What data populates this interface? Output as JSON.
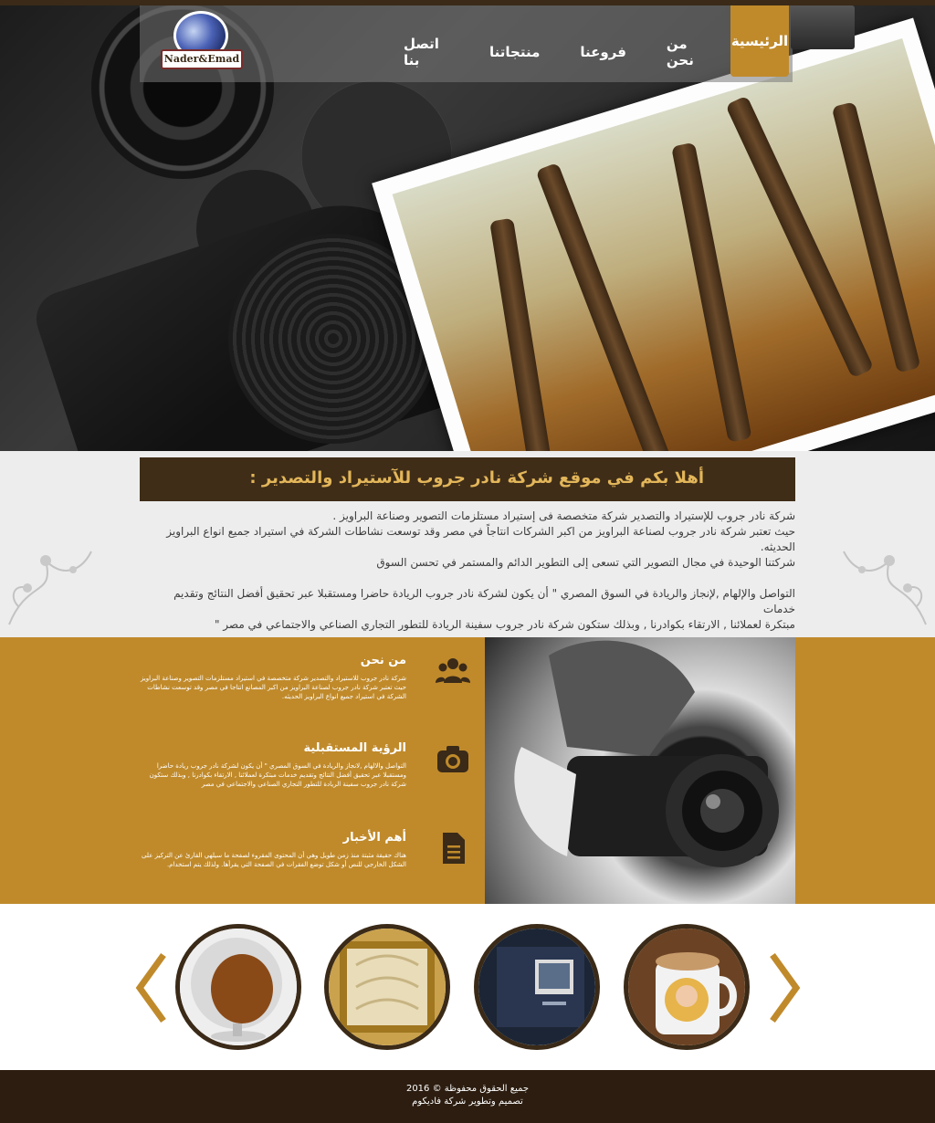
{
  "brand": {
    "logo_text": "Nader&Emad"
  },
  "nav": {
    "active": "الرئيسية",
    "items": [
      "من نحن",
      "فروعنا",
      "منتجاتنا",
      "اتصل بنا"
    ]
  },
  "welcome": {
    "title": "أهلا بكم في موقع شركة نادر جروب للآستيراد والتصدير :",
    "lines": [
      "شركة نادر جروب للإستيراد والتصدير شركة متخصصة فى إستيراد مستلزمات التصوير وصناعة البراويز .",
      "حيث تعتبر شركة نادر جروب لصناعة البراويز من اكبر الشركات انتاجاً في مصر وقد توسعت نشاطات الشركة في استيراد جميع انواع البراويز الحديثه.",
      "شركتنا الوحيدة في مجال التصوير التي تسعى إلى التطوير الدائم والمستمر في تحسن السوق",
      "التواصل والإلهام ,لإنجاز والريادة في السوق المصري \" أن يكون لشركة نادر جروب الريادة حاضرا ومستقبلا عبر تحقيق أفضل النتائج وتقديم خدمات",
      "مبتكرة لعملائنا , الارتقاء بكوادرنا , وبذلك ستكون شركة نادر جروب سفينة الريادة للتطور التجاري الصناعي والاجتماعي في مصر \""
    ]
  },
  "features": [
    {
      "title": "من نحن",
      "icon": "users-icon",
      "desc": "شركة نادر جروب للاستيراد والتصدير شركة متخصصة في استيراد مستلزمات التصوير وصناعة البراويز حيث تعتبر شركة نادر جروب لصناعة البراويز من اكبر المصانع انتاجا في مصر وقد توسعت نشاطات الشركة في استيراد جميع انواع البراويز الحديثه."
    },
    {
      "title": "الرؤية المستقبلية",
      "icon": "camera-icon",
      "desc": "التواصل والالهام ,لانجاز والريادة في السوق المصري \" أن يكون لشركة نادر جروب ريادة حاضرا ومستقبلا عبر تحقيق أفضل النتائج وتقديم خدمات مبتكرة لعملائنا , الارتقاء بكوادرنا , وبذلك ستكون شركة نادر جروب سفينة الريادة للتطور التجاري الصناعي والاجتماعي في مصر"
    },
    {
      "title": "أهم الأخبار",
      "icon": "document-icon",
      "desc": "هناك حقيقة مثبتة منذ زمن طويل وهي أن المحتوى المقروء لصفحة ما سيلهي القارئ عن التركيز على الشكل الخارجي للنص أو شكل توضع الفقرات في الصفحة التي يقرأها. ولذلك يتم استخدام."
    }
  ],
  "carousel": {
    "items": [
      "ball-chair",
      "ornate-frame",
      "photo-album",
      "photo-mug"
    ]
  },
  "footer": {
    "copyright": "جميع الحقوق محفوظة © 2016",
    "credit": "تصميم وتطوير شركة فاديكوم"
  },
  "colors": {
    "accent": "#c08a2b",
    "dark": "#3f2d18",
    "footer": "#2c1d10"
  }
}
